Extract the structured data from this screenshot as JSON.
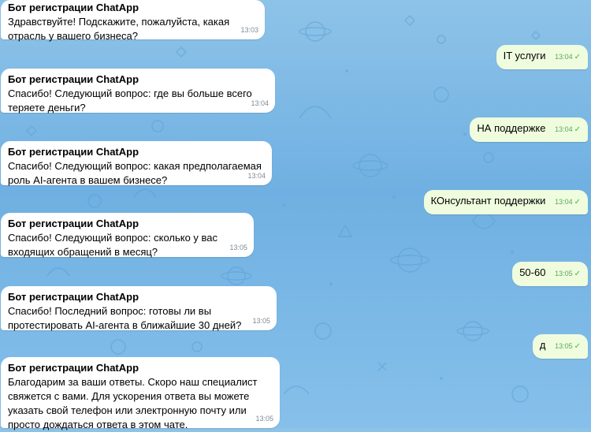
{
  "colors": {
    "background": "#7fbbe6",
    "incoming_bubble": "#ffffff",
    "outgoing_bubble": "#effdde",
    "timestamp": "#7c8b93",
    "outgoing_time": "#5aa55e"
  },
  "messages": [
    {
      "direction": "in",
      "sender": "Бот регистрации ChatApp",
      "text": "Здравствуйте! Подскажите, пожалуйста, какая отрасль у вашего бизнеса?",
      "time": "13:03"
    },
    {
      "direction": "out",
      "text": "IT услуги",
      "time": "13:04",
      "status_icon": "check-icon"
    },
    {
      "direction": "in",
      "sender": "Бот регистрации ChatApp",
      "text": "Спасибо! Следующий вопрос: где вы больше всего теряете деньги?",
      "time": "13:04"
    },
    {
      "direction": "out",
      "text": "НА поддержке",
      "time": "13:04",
      "status_icon": "check-icon"
    },
    {
      "direction": "in",
      "sender": "Бот регистрации ChatApp",
      "text": "Спасибо! Следующий вопрос: какая предполагаемая роль AI-агента в вашем бизнесе?",
      "time": "13:04"
    },
    {
      "direction": "out",
      "text": "КОнсультант поддержки",
      "time": "13:04",
      "status_icon": "check-icon"
    },
    {
      "direction": "in",
      "sender": "Бот регистрации ChatApp",
      "text": "Спасибо! Следующий вопрос: сколько у вас входящих обращений в месяц?",
      "time": "13:05"
    },
    {
      "direction": "out",
      "text": "50-60",
      "time": "13:05",
      "status_icon": "check-icon"
    },
    {
      "direction": "in",
      "sender": "Бот регистрации ChatApp",
      "text": "Спасибо! Последний вопрос: готовы ли вы протестировать AI-агента в ближайшие 30 дней?",
      "time": "13:05"
    },
    {
      "direction": "out",
      "text": "д",
      "time": "13:05",
      "status_icon": "check-icon"
    },
    {
      "direction": "in",
      "sender": "Бот регистрации ChatApp",
      "text": "Благодарим за ваши ответы. Скоро наш специалист свяжется с вами. Для ускорения ответа вы можете указать свой телефон или электронную почту или просто дождаться ответа в этом чате.",
      "time": "13:05"
    }
  ]
}
